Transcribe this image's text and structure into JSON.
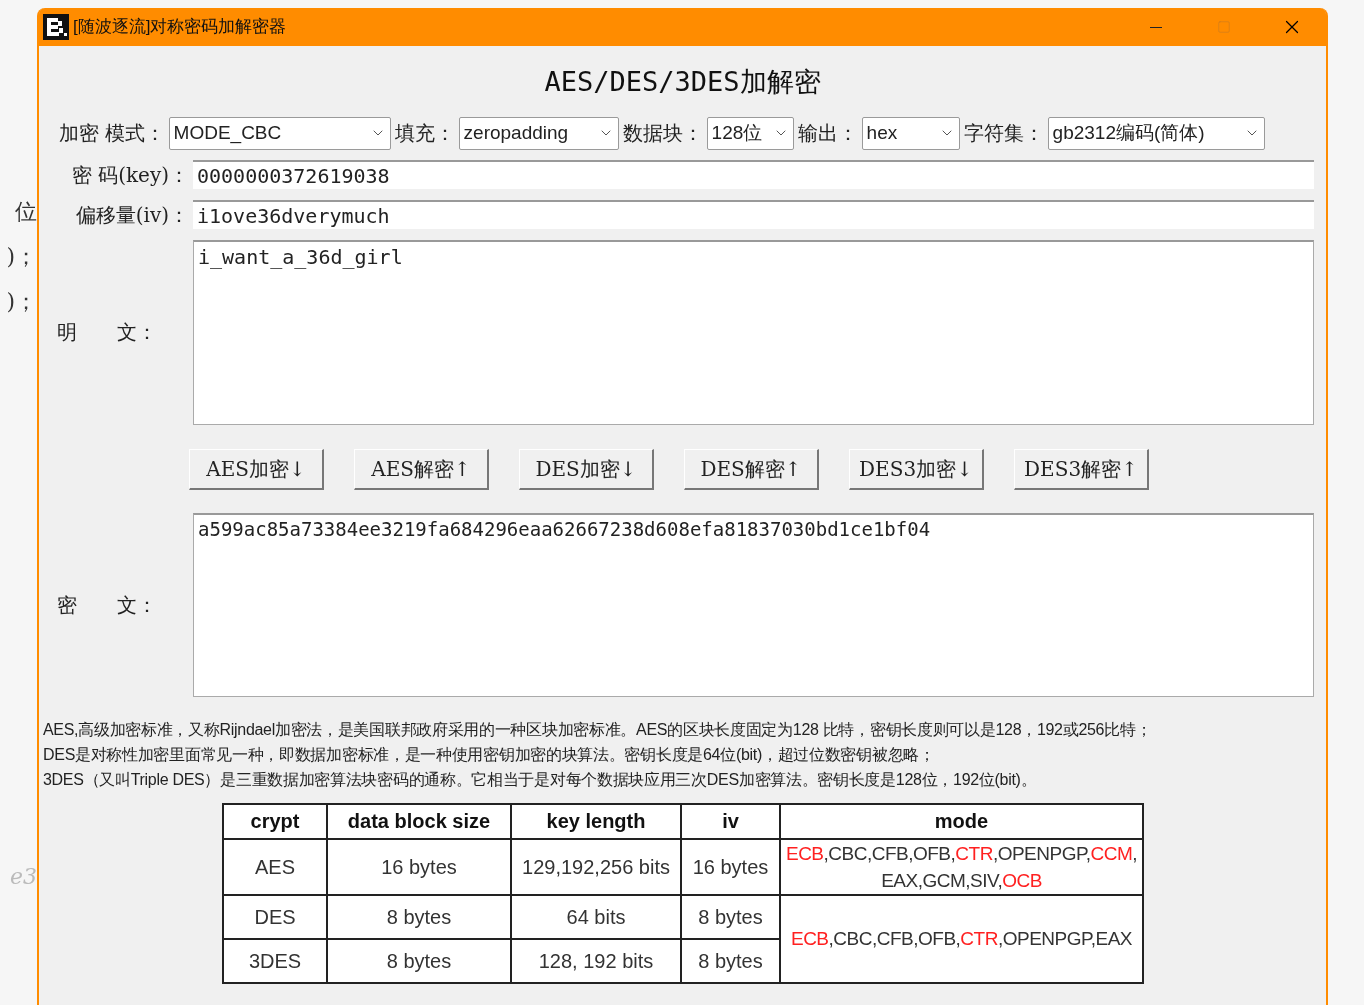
{
  "background_fragments": [
    "位",
    ")；",
    ")；",
    "e3"
  ],
  "window": {
    "title": "[随波逐流]对称密码加解密器"
  },
  "heading": "AES/DES/3DES加解密",
  "options": [
    {
      "label": "加密 模式：",
      "value": "MODE_CBC"
    },
    {
      "label": "填充：",
      "value": "zeropadding"
    },
    {
      "label": "数据块：",
      "value": "128位"
    },
    {
      "label": "输出：",
      "value": "hex"
    },
    {
      "label": "字符集：",
      "value": "gb2312编码(简体)"
    }
  ],
  "key": {
    "label": "密 码(key)：",
    "value": "0000000372619038"
  },
  "iv": {
    "label": "偏移量(iv)：",
    "value": "i1ove36dverymuch"
  },
  "plaintext": {
    "label": "明　　文：",
    "value": "i_want_a_36d_girl"
  },
  "buttons": [
    "AES加密↓",
    "AES解密↑",
    "DES加密↓",
    "DES解密↑",
    "DES3加密↓",
    "DES3解密↑"
  ],
  "ciphertext": {
    "label": "密　　文：",
    "value": "a599ac85a73384ee3219fa684296eaa62667238d608efa81837030bd1ce1bf04"
  },
  "description": [
    "AES,高级加密标准，又称Rijndael加密法，是美国联邦政府采用的一种区块加密标准。AES的区块长度固定为128 比特，密钥长度则可以是128，192或256比特；",
    "DES是对称性加密里面常见一种，即数据加密标准，是一种使用密钥加密的块算法。密钥长度是64位(bit)，超过位数密钥被忽略；",
    "3DES（又叫Triple DES）是三重数据加密算法块密码的通称。它相当于是对每个数据块应用三次DES加密算法。密钥长度是128位，192位(bit)。"
  ],
  "table": {
    "columns": [
      "crypt",
      "data block size",
      "key length",
      "iv",
      "mode"
    ],
    "rows": [
      {
        "cells": [
          "AES",
          "16 bytes",
          "129,192,256 bits",
          "16 bytes"
        ],
        "mode": [
          {
            "text": "ECB",
            "color": "#ff2020"
          },
          {
            "text": ",CBC,CFB,OFB,",
            "color": "#333333"
          },
          {
            "text": "CTR",
            "color": "#ff2020"
          },
          {
            "text": ",OPENPGP,",
            "color": "#333333"
          },
          {
            "text": "CCM",
            "color": "#ff2020"
          },
          {
            "text": ",EAX,GCM,SIV,",
            "color": "#333333"
          },
          {
            "text": "OCB",
            "color": "#ff2020"
          }
        ]
      },
      {
        "cells": [
          "DES",
          "8 bytes",
          "64 bits",
          "8 bytes"
        ],
        "mode": [
          {
            "text": "ECB",
            "color": "#ff2020"
          },
          {
            "text": ",CBC,CFB,OFB,",
            "color": "#333333"
          },
          {
            "text": "CTR",
            "color": "#ff2020"
          },
          {
            "text": ",OPENPGP,EAX",
            "color": "#333333"
          }
        ]
      },
      {
        "cells": [
          "3DES",
          "8 bytes",
          "128, 192 bits",
          "8 bytes"
        ]
      }
    ]
  }
}
